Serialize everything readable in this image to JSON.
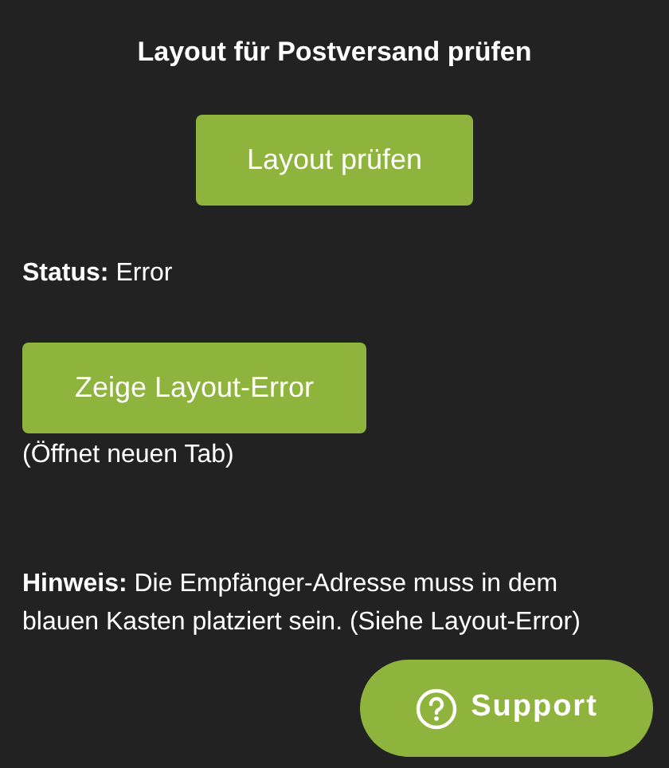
{
  "title": "Layout für Postversand prüfen",
  "check_button": "Layout prüfen",
  "status": {
    "label": "Status:",
    "value": "Error"
  },
  "show_error_button": "Zeige Layout-Error",
  "show_error_note": "(Öffnet neuen Tab)",
  "hint": "**Hinweis:** Die Empfänger-Adresse muss in dem blauen Kasten platziert sein. (Siehe Layout-Error)",
  "support_button": "Support"
}
